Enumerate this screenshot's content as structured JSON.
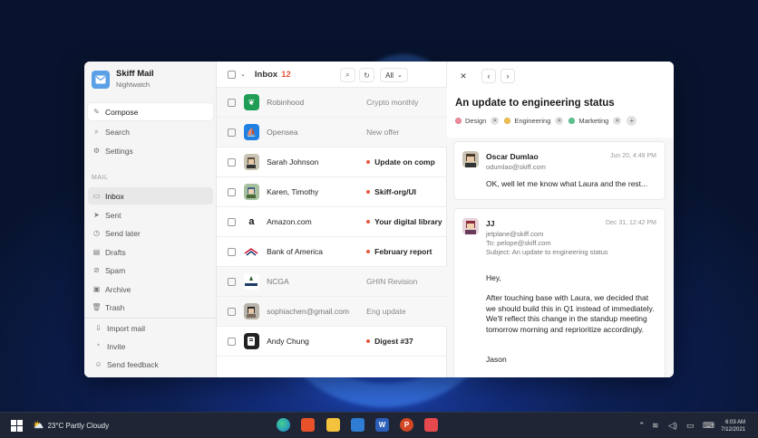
{
  "app": {
    "name": "Skiff Mail",
    "account": "Nightwatch"
  },
  "sidebar": {
    "compose": "Compose",
    "search": "Search",
    "settings": "Settings",
    "section_label": "MAIL",
    "items": [
      {
        "label": "Inbox",
        "icon": "inbox-icon"
      },
      {
        "label": "Sent",
        "icon": "send-icon"
      },
      {
        "label": "Send later",
        "icon": "clock-send-icon"
      },
      {
        "label": "Drafts",
        "icon": "draft-icon"
      },
      {
        "label": "Spam",
        "icon": "spam-icon"
      },
      {
        "label": "Archive",
        "icon": "archive-icon"
      },
      {
        "label": "Trash",
        "icon": "trash-icon"
      }
    ],
    "footer": [
      {
        "label": "Import mail",
        "icon": "import-icon"
      },
      {
        "label": "Invite",
        "icon": "invite-icon"
      },
      {
        "label": "Send feedback",
        "icon": "feedback-icon"
      }
    ]
  },
  "list": {
    "title": "Inbox",
    "count": "12",
    "filter": "All",
    "rows": [
      {
        "sender": "Robinhood",
        "subject": "Crypto monthly",
        "read": true,
        "unread_dot": false,
        "avatar_color": "#1f9d55"
      },
      {
        "sender": "Opensea",
        "subject": "New offer",
        "read": true,
        "unread_dot": false,
        "avatar_color": "#2081e2"
      },
      {
        "sender": "Sarah Johnson",
        "subject": "Update on comp",
        "read": false,
        "unread_dot": true,
        "avatar_color": "#c9c3b3"
      },
      {
        "sender": "Karen, Timothy",
        "subject": "Skiff-org/UI",
        "read": false,
        "unread_dot": true,
        "avatar_color": "#a7c1a0"
      },
      {
        "sender": "Amazon.com",
        "subject": "Your digital library",
        "read": false,
        "unread_dot": true,
        "avatar_color": "#ffffff"
      },
      {
        "sender": "Bank of America",
        "subject": "February report",
        "read": false,
        "unread_dot": true,
        "avatar_color": "#ffffff"
      },
      {
        "sender": "NCGA",
        "subject": "GHIN Revision",
        "read": true,
        "unread_dot": false,
        "avatar_color": "#ffffff"
      },
      {
        "sender": "sophiachen@gmail.com",
        "subject": "Eng update",
        "read": true,
        "unread_dot": false,
        "avatar_color": "#b9b4a9"
      },
      {
        "sender": "Andy Chung",
        "subject": "Digest #37",
        "read": false,
        "unread_dot": true,
        "avatar_color": "#222222"
      }
    ]
  },
  "pane": {
    "title": "An update to engineering status",
    "tags": [
      {
        "label": "Design",
        "color": "#f28b9b"
      },
      {
        "label": "Engineering",
        "color": "#f2c14e"
      },
      {
        "label": "Marketing",
        "color": "#5cc48f"
      }
    ],
    "messages": [
      {
        "from": "Oscar Dumlao",
        "address": "odumlao@skiff.com",
        "date": "Jun 20, 4:49 PM",
        "body": "OK, well let me know what Laura and the rest..."
      },
      {
        "from": "JJ",
        "address": "jetplane@skiff.com",
        "to": "To: pelope@skiff.com",
        "subject": "Subject: An update to engineering status",
        "date": "Dec 31, 12:42 PM",
        "greeting": "Hey,",
        "body": "After touching base with Laura, we decided that we should build this in Q1 instead of immediately. We'll reflect this change in the standup meeting tomorrow morning and reprioritize accordingly.",
        "signature": "Jason"
      }
    ]
  },
  "taskbar": {
    "weather": "23°C Partly Cloudy",
    "time": "6:03 AM",
    "date": "7/12/2021"
  }
}
